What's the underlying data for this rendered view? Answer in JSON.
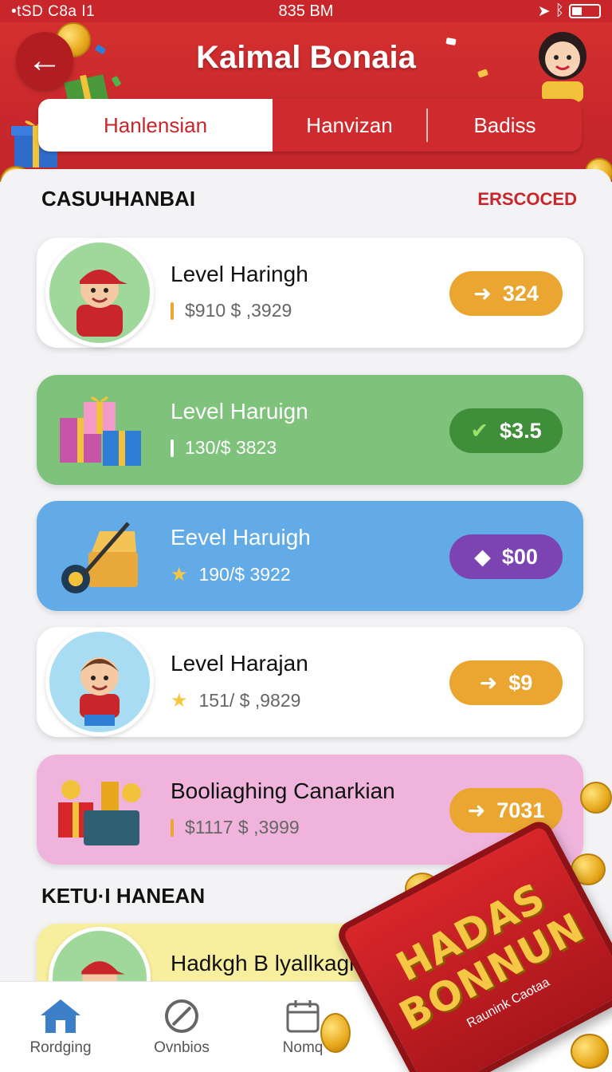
{
  "status_bar": {
    "left": "•tSD C8a ⅼ1",
    "time": "835 BM"
  },
  "header": {
    "title": "Kaimal Bonaia"
  },
  "tabs": [
    {
      "label": "Hanlensian",
      "active": true
    },
    {
      "label": "Hanvizan",
      "active": false
    },
    {
      "label": "Badiss",
      "active": false
    }
  ],
  "section1": {
    "title": "CASUЧHANBAI",
    "link": "ERSCOCED"
  },
  "cards": [
    {
      "name": "Level Haringh",
      "sub": "$910 $ ,3929",
      "reward": "324",
      "style": "white",
      "icon": "arrow-right-icon"
    },
    {
      "name": "Level Haruign",
      "sub": "130/$ 3823",
      "reward": "$3.5",
      "style": "green",
      "icon": "check-icon"
    },
    {
      "name": "Eevel Haruigh",
      "sub": "190/$ 3922",
      "reward": "$00",
      "style": "blue",
      "icon": "tag-icon"
    },
    {
      "name": "Level Harajan",
      "sub": "151/ $ ,9829",
      "reward": "$9",
      "style": "white",
      "icon": "arrow-right-icon"
    },
    {
      "name": "Booliaghing Canarkian",
      "sub": "$1117 $ ,3999",
      "reward": "7031",
      "style": "pink",
      "icon": "arrow-right-icon"
    }
  ],
  "section2": {
    "title": "KETU·I HANEAN"
  },
  "partial_card": {
    "name": "Hadkgh B lyallkagi"
  },
  "bottom_nav": [
    {
      "label": "Rordging",
      "icon": "home-icon"
    },
    {
      "label": "Ovnbios",
      "icon": "block-icon"
    },
    {
      "label": "Nomq",
      "icon": "calendar-icon"
    }
  ],
  "bonus_banner": {
    "line1": "HADAS",
    "line2": "BONNUN",
    "tagline": "Raunink Caotaa"
  },
  "colors": {
    "brand_red": "#c8262b",
    "pill_orange": "#eaa631",
    "pill_green": "#3f8f3a",
    "pill_purple": "#7c44b3",
    "gold": "#f6c744"
  }
}
